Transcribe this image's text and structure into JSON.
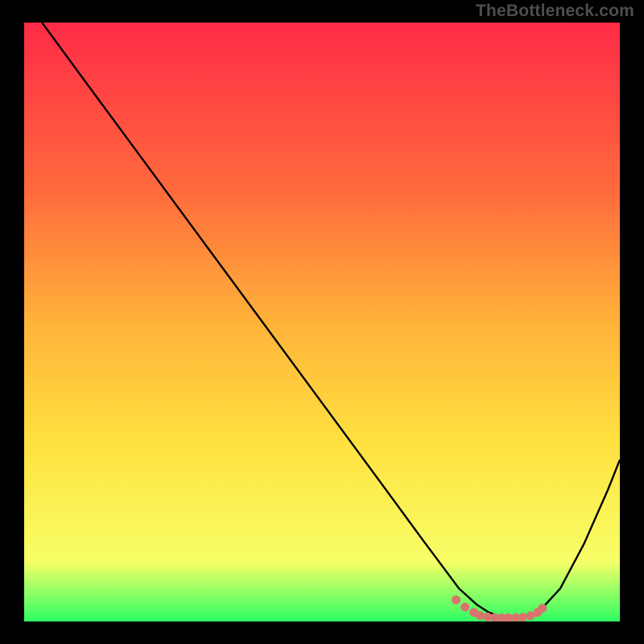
{
  "watermark": "TheBottleneck.com",
  "colors": {
    "bg": "#000000",
    "grad_top": "#ff2b47",
    "grad_mid1": "#ff6a3c",
    "grad_mid2": "#ffb23a",
    "grad_mid3": "#ffe13f",
    "grad_low": "#f7ff67",
    "grad_bottom": "#2dff62",
    "line": "#000000",
    "marker": "#d9736e"
  },
  "chart_data": {
    "type": "line",
    "title": "",
    "xlabel": "",
    "ylabel": "",
    "xlim": [
      0,
      100
    ],
    "ylim": [
      0,
      100
    ],
    "series": [
      {
        "name": "curve",
        "x": [
          3,
          10,
          20,
          30,
          40,
          50,
          60,
          67,
          70,
          73,
          76,
          78,
          80,
          82,
          84,
          86,
          90,
          94,
          98,
          100
        ],
        "values": [
          100,
          90.5,
          77,
          63.5,
          50,
          36.5,
          23,
          13.5,
          9.5,
          5.5,
          2.8,
          1.5,
          0.8,
          0.6,
          0.6,
          1.2,
          5.5,
          13,
          22,
          27
        ]
      }
    ],
    "markers": {
      "name": "bottom-cluster",
      "x": [
        72.5,
        74,
        75.5,
        76.5,
        77.8,
        79,
        80.2,
        81.3,
        82.5,
        83.7,
        85,
        86.2,
        87
      ],
      "values": [
        3.6,
        2.4,
        1.5,
        1.0,
        0.75,
        0.65,
        0.6,
        0.6,
        0.62,
        0.7,
        0.95,
        1.5,
        2.2
      ]
    }
  }
}
